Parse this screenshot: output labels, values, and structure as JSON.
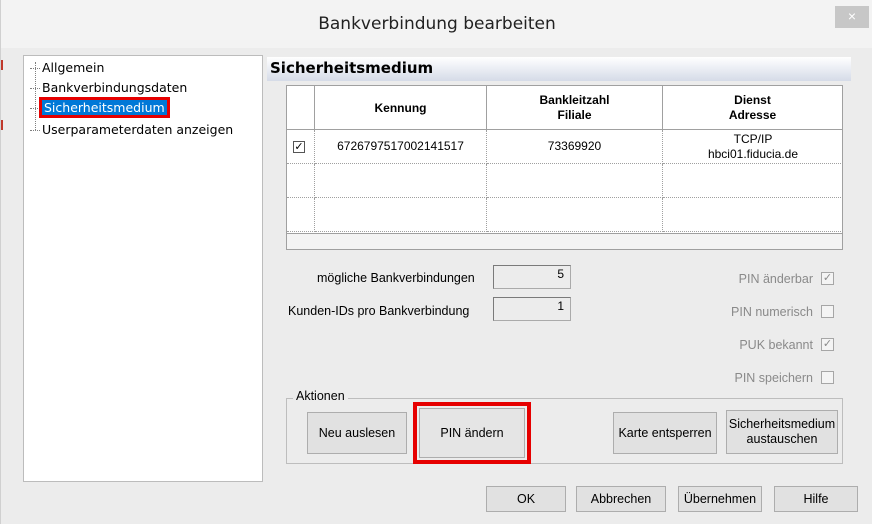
{
  "window": {
    "title": "Bankverbindung bearbeiten",
    "close_glyph": "×"
  },
  "tree": {
    "items": [
      {
        "label": "Allgemein"
      },
      {
        "label": "Bankverbindungsdaten"
      },
      {
        "label": "Sicherheitsmedium",
        "selected": true
      },
      {
        "label": "Userparameterdaten anzeigen"
      }
    ]
  },
  "section": {
    "title": "Sicherheitsmedium"
  },
  "table": {
    "headers": [
      "Kennung",
      "Bankleitzahl\nFiliale",
      "Dienst\nAdresse"
    ],
    "header_lines": {
      "blz_1": "Bankleitzahl",
      "blz_2": "Filiale",
      "dienst_1": "Dienst",
      "dienst_2": "Adresse"
    },
    "rows": [
      {
        "checked": true,
        "kennung": "6726797517002141517",
        "blz": "73369920",
        "dienst_1": "TCP/IP",
        "dienst_2": "hbci01.fiducia.de"
      }
    ],
    "check_glyph": "✓"
  },
  "info": {
    "moegliche_label": "mögliche Bankverbindungen",
    "moegliche_value": "5",
    "kunden_label": "Kunden-IDs pro Bankverbindung",
    "kunden_value": "1"
  },
  "options": [
    {
      "label": "PIN änderbar",
      "checked": true
    },
    {
      "label": "PIN numerisch",
      "checked": false
    },
    {
      "label": "PUK bekannt",
      "checked": true
    },
    {
      "label": "PIN speichern",
      "checked": false
    }
  ],
  "actions": {
    "group_title": "Aktionen",
    "neu_auslesen": "Neu auslesen",
    "pin_aendern": "PIN ändern",
    "karte_entsperren": "Karte entsperren",
    "medium_1": "Sicherheitsmedium",
    "medium_2": "austauschen"
  },
  "footer": {
    "ok": "OK",
    "abbrechen": "Abbrechen",
    "uebernehmen": "Übernehmen",
    "hilfe": "Hilfe"
  },
  "colors": {
    "highlight_red": "#e60000",
    "selection_blue": "#0078d7"
  }
}
